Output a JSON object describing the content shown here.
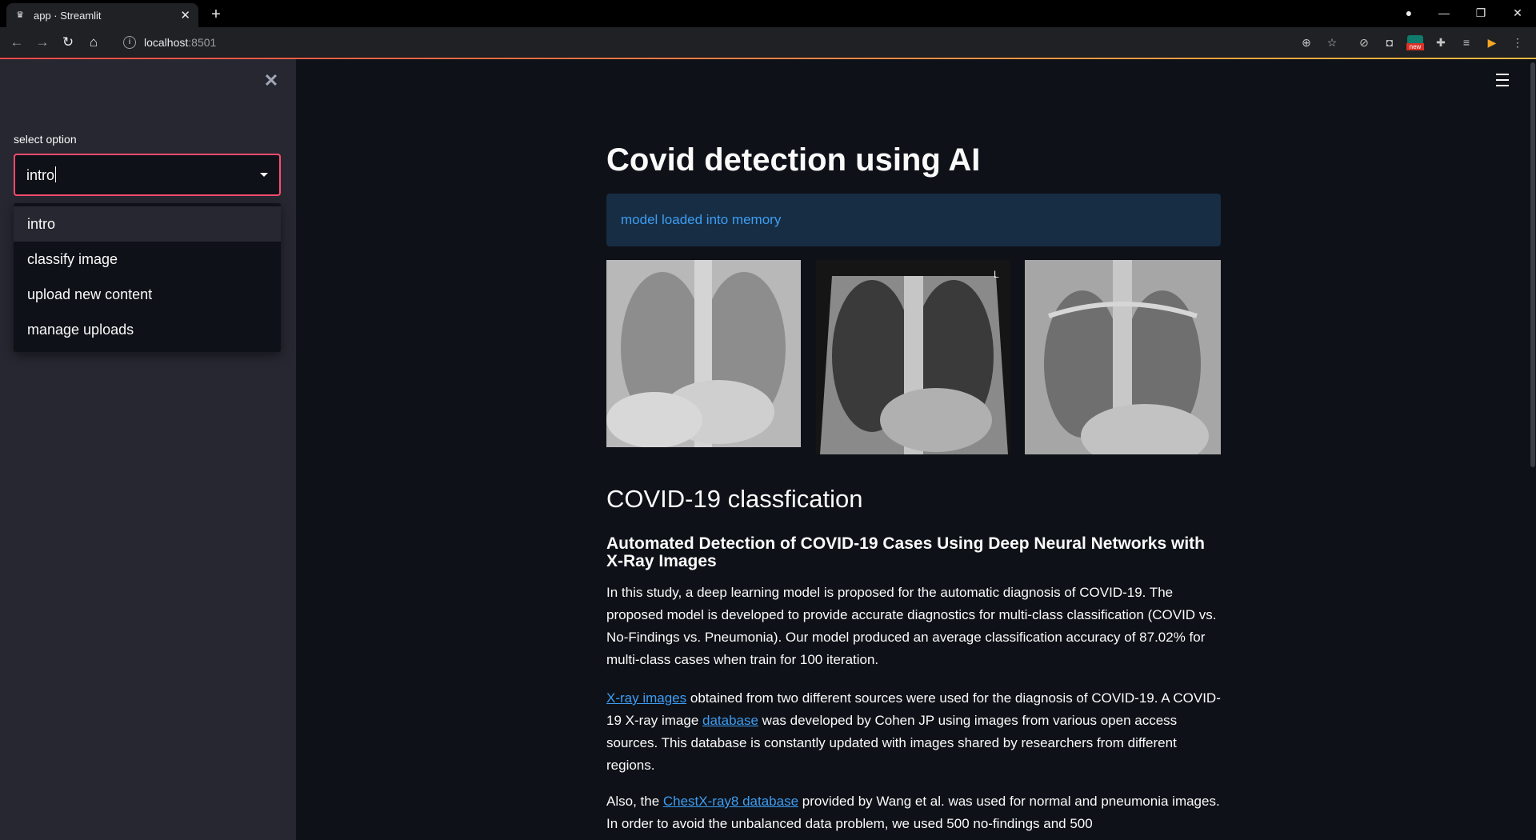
{
  "browser": {
    "tab_title": "app · Streamlit",
    "url_host": "localhost",
    "url_port": ":8501",
    "badge_new": "new"
  },
  "sidebar": {
    "select_label": "select option",
    "select_value": "intro",
    "options": [
      "intro",
      "classify image",
      "upload new content",
      "manage uploads"
    ]
  },
  "main": {
    "title": "Covid detection using AI",
    "info_message": "model loaded into memory",
    "section_title": "COVID-19 classfication",
    "paper_title": "Automated Detection of COVID-19 Cases Using Deep Neural Networks with X-Ray Images",
    "para1": "In this study, a deep learning model is proposed for the automatic diagnosis of COVID-19. The proposed model is developed to provide accurate diagnostics for multi-class classification (COVID vs. No-Findings vs. Pneumonia). Our model produced an average classification accuracy of 87.02% for multi-class cases when train for 100 iteration.",
    "para2": {
      "link1": "X-ray images",
      "text1": " obtained from two different sources were used for the diagnosis of COVID-19. A COVID-19 X-ray image ",
      "link2": "database",
      "text2": " was developed by Cohen JP using images from various open access sources. This database is constantly updated with images shared by researchers from different regions."
    },
    "para3": {
      "text1": "Also, the ",
      "link1": "ChestX-ray8 database",
      "text2": " provided by Wang et al. was used for normal and pneumonia images. In order to avoid the unbalanced data problem, we used 500 no-findings and 500"
    }
  },
  "colors": {
    "accent": "#ff4b4b",
    "info_bg": "#172d43",
    "info_text": "#3d9df3",
    "sidebar_bg": "#262730",
    "main_bg": "#0e1117"
  }
}
